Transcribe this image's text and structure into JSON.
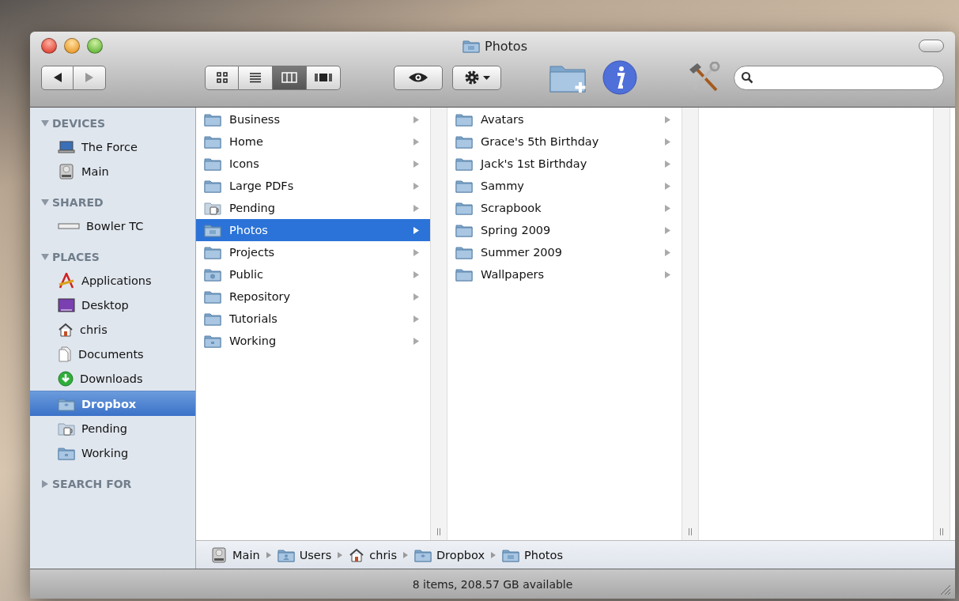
{
  "window": {
    "title": "Photos"
  },
  "toolbar": {
    "view_buttons": [
      {
        "kind": "icons",
        "selected": false
      },
      {
        "kind": "list",
        "selected": false
      },
      {
        "kind": "columns",
        "selected": true
      },
      {
        "kind": "coverflow",
        "selected": false
      }
    ]
  },
  "sidebar": {
    "sections": [
      {
        "label": "DEVICES",
        "expanded": true,
        "items": [
          {
            "label": "The Force",
            "kind": "laptop",
            "selected": false
          },
          {
            "label": "Main",
            "kind": "drive",
            "selected": false
          }
        ]
      },
      {
        "label": "SHARED",
        "expanded": true,
        "items": [
          {
            "label": "Bowler TC",
            "kind": "server",
            "selected": false
          }
        ]
      },
      {
        "label": "PLACES",
        "expanded": true,
        "items": [
          {
            "label": "Applications",
            "kind": "apps",
            "selected": false
          },
          {
            "label": "Desktop",
            "kind": "desktop",
            "selected": false
          },
          {
            "label": "chris",
            "kind": "home",
            "selected": false
          },
          {
            "label": "Documents",
            "kind": "documents",
            "selected": false
          },
          {
            "label": "Downloads",
            "kind": "downloads",
            "selected": false
          },
          {
            "label": "Dropbox",
            "kind": "dropbox",
            "selected": true
          },
          {
            "label": "Pending",
            "kind": "pending",
            "selected": false
          },
          {
            "label": "Working",
            "kind": "working",
            "selected": false
          }
        ]
      },
      {
        "label": "SEARCH FOR",
        "expanded": false
      }
    ]
  },
  "columns": [
    {
      "items": [
        {
          "label": "Business",
          "kind": "folder",
          "selected": false
        },
        {
          "label": "Home",
          "kind": "folder",
          "selected": false
        },
        {
          "label": "Icons",
          "kind": "folder",
          "selected": false
        },
        {
          "label": "Large PDFs",
          "kind": "folder",
          "selected": false
        },
        {
          "label": "Pending",
          "kind": "pending",
          "selected": false
        },
        {
          "label": "Photos",
          "kind": "photos",
          "selected": true
        },
        {
          "label": "Projects",
          "kind": "folder",
          "selected": false
        },
        {
          "label": "Public",
          "kind": "public",
          "selected": false
        },
        {
          "label": "Repository",
          "kind": "folder",
          "selected": false
        },
        {
          "label": "Tutorials",
          "kind": "folder",
          "selected": false
        },
        {
          "label": "Working",
          "kind": "working",
          "selected": false
        }
      ]
    },
    {
      "items": [
        {
          "label": "Avatars",
          "kind": "folder",
          "selected": false
        },
        {
          "label": "Grace's 5th Birthday",
          "kind": "folder",
          "selected": false
        },
        {
          "label": "Jack's 1st Birthday",
          "kind": "folder",
          "selected": false
        },
        {
          "label": "Sammy",
          "kind": "folder",
          "selected": false
        },
        {
          "label": "Scrapbook",
          "kind": "folder",
          "selected": false
        },
        {
          "label": "Spring 2009",
          "kind": "folder",
          "selected": false
        },
        {
          "label": "Summer 2009",
          "kind": "folder",
          "selected": false
        },
        {
          "label": "Wallpapers",
          "kind": "folder",
          "selected": false
        }
      ]
    }
  ],
  "path_bar": [
    {
      "label": "Main",
      "kind": "drive"
    },
    {
      "label": "Users",
      "kind": "users"
    },
    {
      "label": "chris",
      "kind": "home"
    },
    {
      "label": "Dropbox",
      "kind": "dropbox"
    },
    {
      "label": "Photos",
      "kind": "photos"
    }
  ],
  "status_bar": {
    "text": "8 items, 208.57 GB available"
  }
}
